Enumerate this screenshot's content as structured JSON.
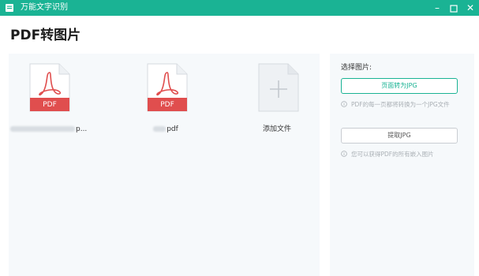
{
  "window": {
    "title": "万能文字识别",
    "icon": "scanner-icon",
    "controls": [
      "minimize-icon",
      "maximize-icon",
      "close-icon"
    ]
  },
  "page": {
    "title": "PDF转图片"
  },
  "files": [
    {
      "name_suffix": "p...",
      "badge": "PDF",
      "name_blurred": true
    },
    {
      "name_suffix": "pdf",
      "badge": "PDF",
      "name_blurred": true
    }
  ],
  "add_file": {
    "label": "添加文件"
  },
  "options": {
    "label": "选择图片:",
    "page_to_jpg": {
      "label": "页面转为JPG",
      "hint": "PDF的每一页都将转换为一个JPG文件"
    },
    "extract_jpg": {
      "label": "提取JPG",
      "hint": "您可以获得PDF的所有嵌入图片"
    }
  },
  "colors": {
    "accent": "#1ab394",
    "pdf_red": "#e04e4e",
    "panel_bg": "#f6f9fb"
  }
}
